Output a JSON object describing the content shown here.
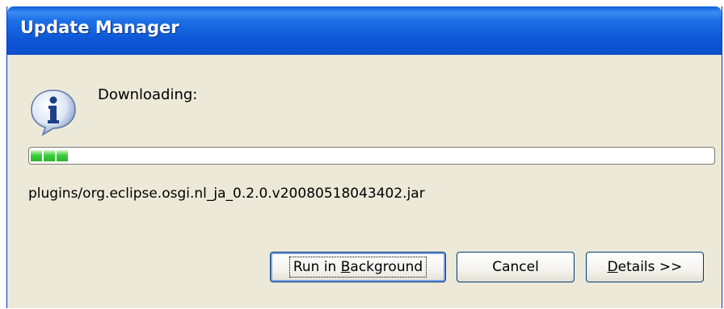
{
  "window": {
    "title": "Update Manager"
  },
  "dialog": {
    "icon": "info-icon",
    "message": "Downloading:",
    "progress_fraction": 0.05,
    "task_name": "plugins/org.eclipse.osgi.nl_ja_0.2.0.v20080518043402.jar"
  },
  "buttons": {
    "run_in_background": {
      "before": "Run in ",
      "mnemonic": "B",
      "after": "ackground"
    },
    "cancel": "Cancel",
    "details": {
      "mnemonic": "D",
      "after": "etails >>"
    }
  },
  "colors": {
    "titlebar": "#0d56d6",
    "dialog_bg": "#ece9d8",
    "progress_green": "#3fce3f"
  }
}
